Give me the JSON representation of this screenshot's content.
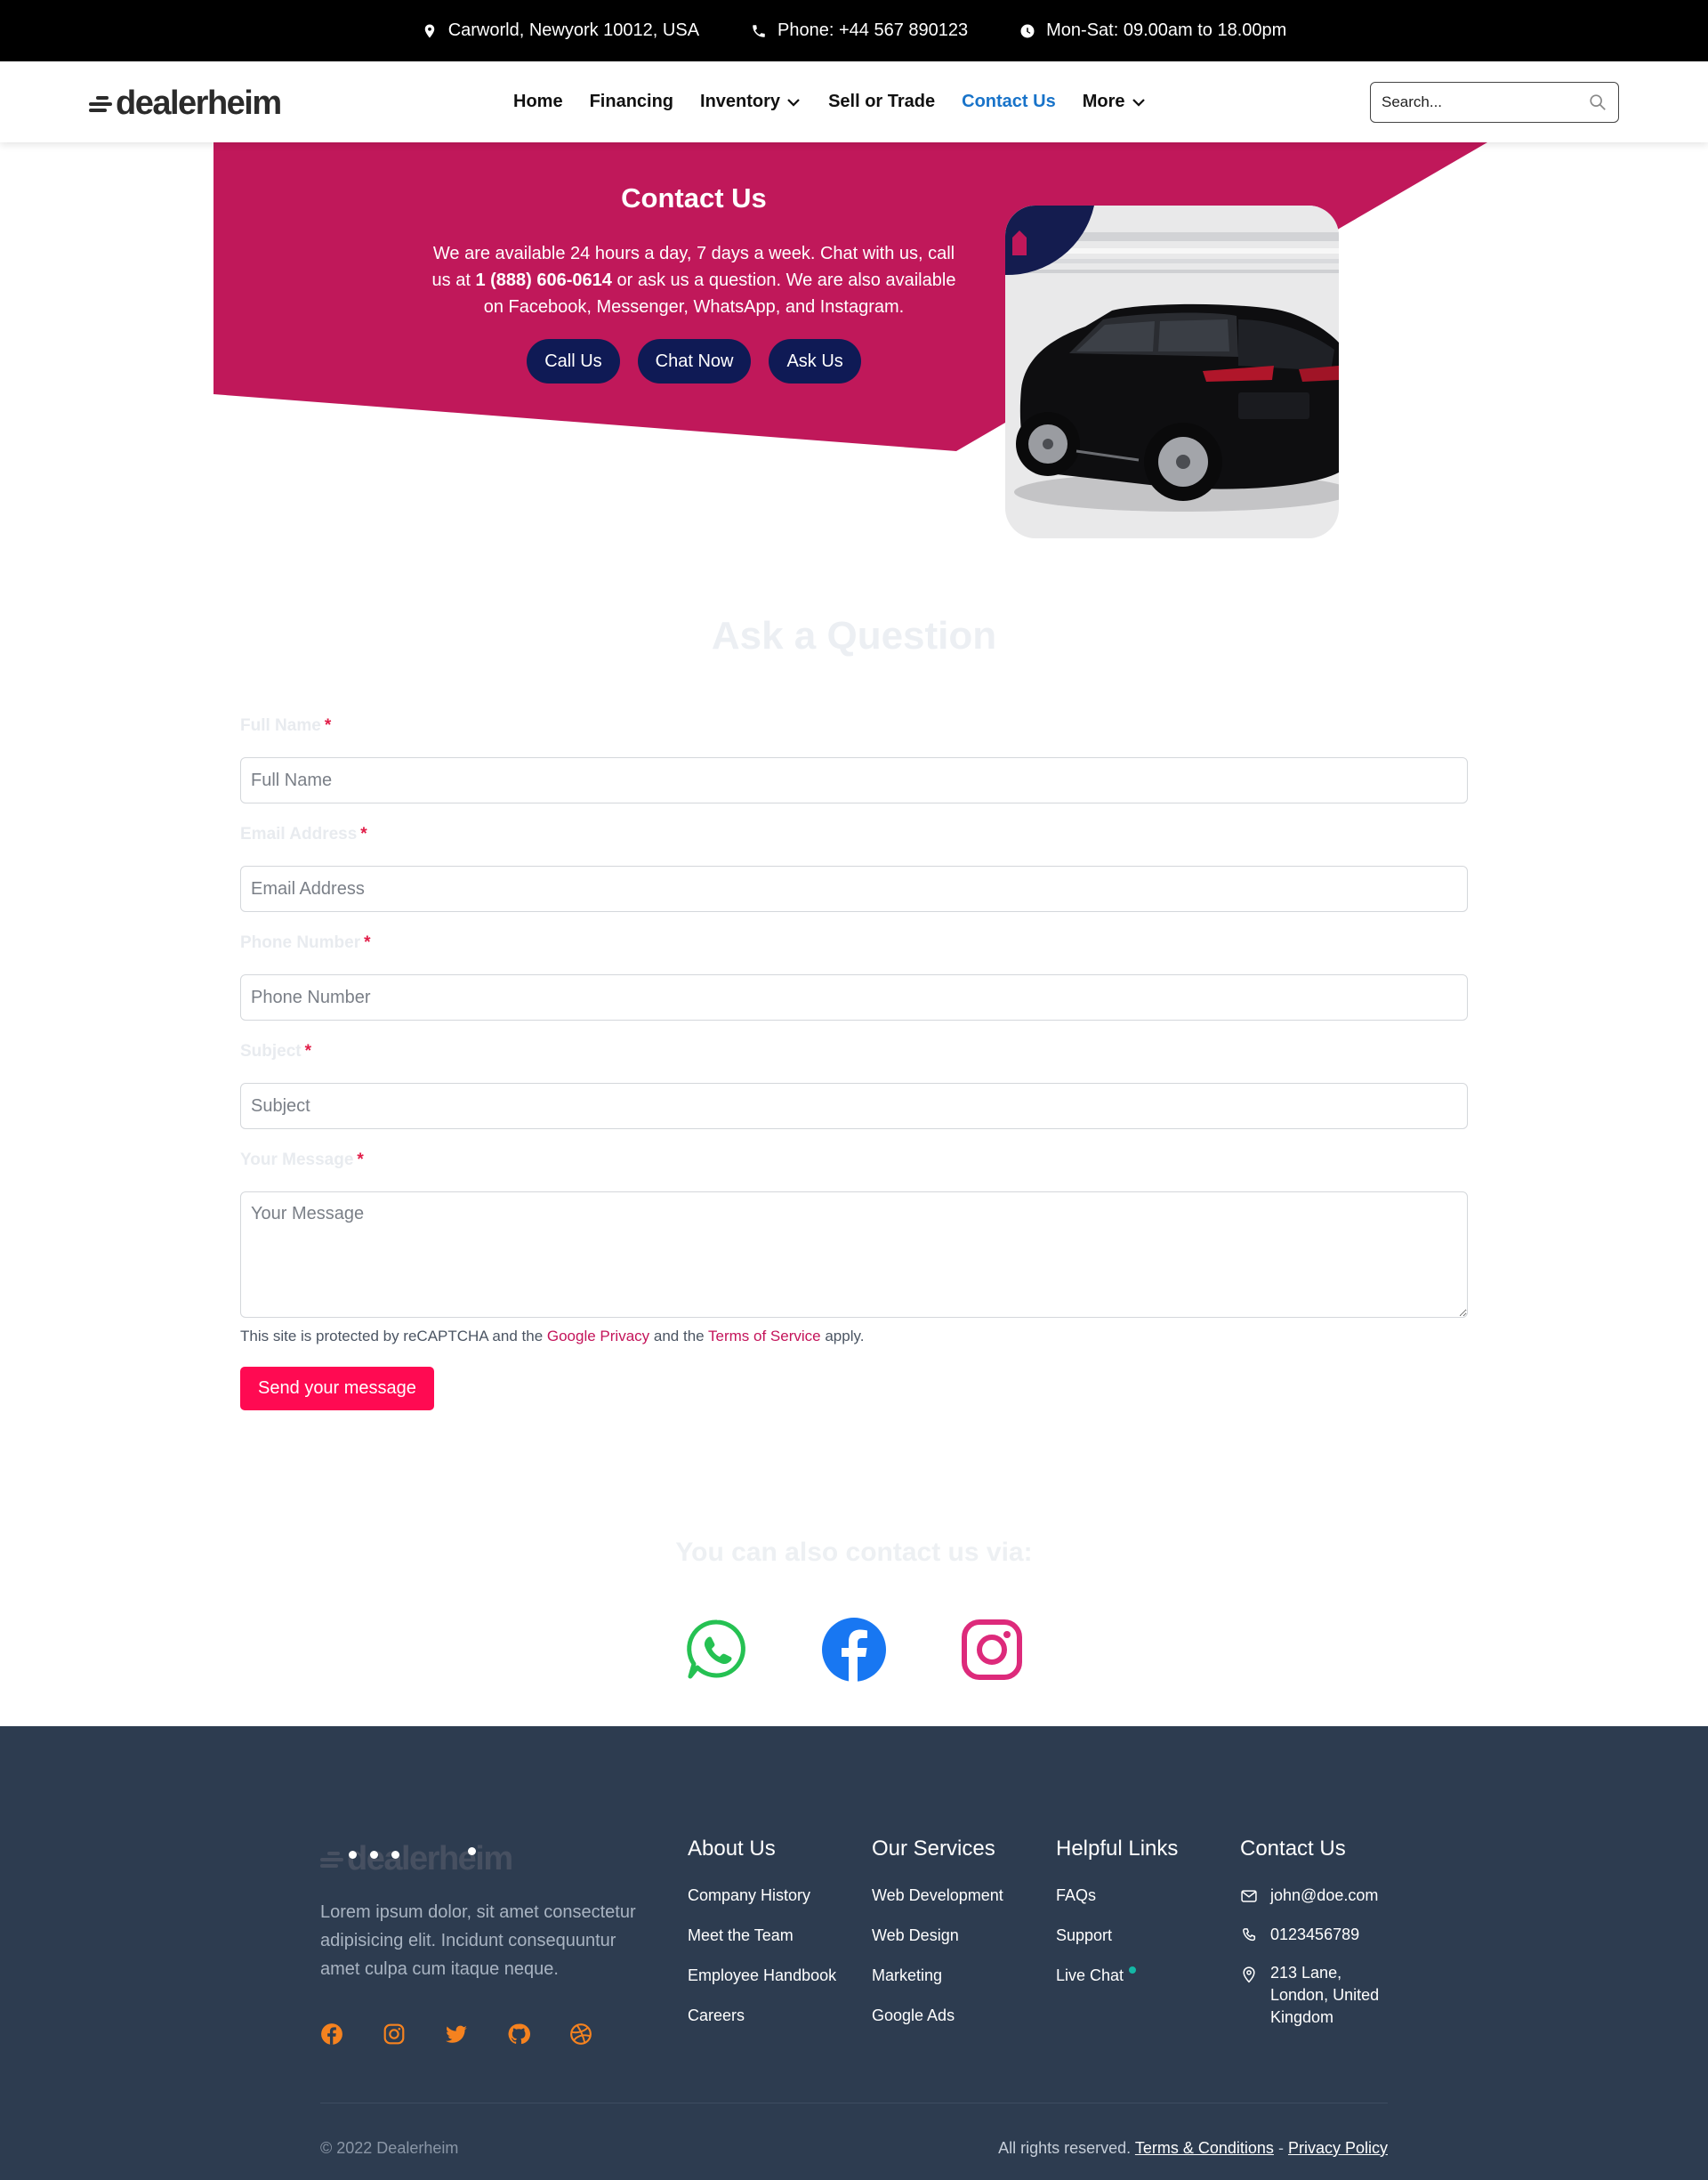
{
  "topbar": {
    "address": "Carworld, Newyork 10012, USA",
    "phone": "Phone: +44 567 890123",
    "hours": "Mon-Sat: 09.00am to 18.00pm"
  },
  "brand": {
    "logo_text": "dealerheim"
  },
  "nav": {
    "items": [
      {
        "label": "Home"
      },
      {
        "label": "Financing"
      },
      {
        "label": "Inventory"
      },
      {
        "label": "Sell or Trade"
      },
      {
        "label": "Contact Us"
      },
      {
        "label": "More"
      }
    ],
    "active": "Contact Us",
    "search_placeholder": "Search..."
  },
  "hero": {
    "title": "Contact Us",
    "text_before": "We are available 24 hours a day, 7 days a week. Chat with us, call us at ",
    "phone": "1 (888) 606-0614",
    "text_after": " or ask us a question. We are also available on Facebook, Messenger, WhatsApp, and Instagram.",
    "buttons": [
      "Call Us",
      "Chat Now",
      "Ask Us"
    ],
    "colors": {
      "banner": "#c0185a",
      "buttons": "#0f1a55"
    }
  },
  "form": {
    "title": "Ask a Question",
    "fields": [
      {
        "label": "Full Name",
        "placeholder": "Full Name"
      },
      {
        "label": "Email Address",
        "placeholder": "Email Address"
      },
      {
        "label": "Phone Number",
        "placeholder": "Phone Number"
      },
      {
        "label": "Subject",
        "placeholder": "Subject"
      },
      {
        "label": "Your Message",
        "placeholder": "Your Message"
      }
    ],
    "required_mark": "*",
    "recaptcha": {
      "prefix": "This site is protected by reCAPTCHA and the ",
      "privacy": "Google Privacy",
      "middle": " and the ",
      "terms": "Terms of Service",
      "suffix": " apply."
    },
    "submit": "Send your message",
    "submit_color": "#ff0a52"
  },
  "contact_via": {
    "title": "You can also contact us via:",
    "channels": [
      "whatsapp-icon",
      "facebook-icon",
      "instagram-icon"
    ]
  },
  "footer": {
    "about": "Lorem ipsum dolor, sit amet consectetur adipisicing elit. Incidunt consequuntur amet culpa cum itaque neque.",
    "social_icons": [
      "facebook-icon",
      "instagram-icon",
      "twitter-icon",
      "github-icon",
      "dribbble-icon"
    ],
    "columns": [
      {
        "title": "About Us",
        "links": [
          "Company History",
          "Meet the Team",
          "Employee Handbook",
          "Careers"
        ]
      },
      {
        "title": "Our Services",
        "links": [
          "Web Development",
          "Web Design",
          "Marketing",
          "Google Ads"
        ]
      },
      {
        "title": "Helpful Links",
        "links": [
          "FAQs",
          "Support",
          "Live Chat"
        ]
      }
    ],
    "contact": {
      "title": "Contact Us",
      "email": "john@doe.com",
      "phone": "0123456789",
      "address": "213 Lane, London, United Kingdom"
    },
    "copyright": "© 2022 Dealerheim",
    "rights": "All rights reserved.",
    "terms": "Terms & Conditions",
    "separator": "-",
    "privacy": "Privacy Policy",
    "background": "#2d3c50",
    "accent": "#f5821f"
  }
}
